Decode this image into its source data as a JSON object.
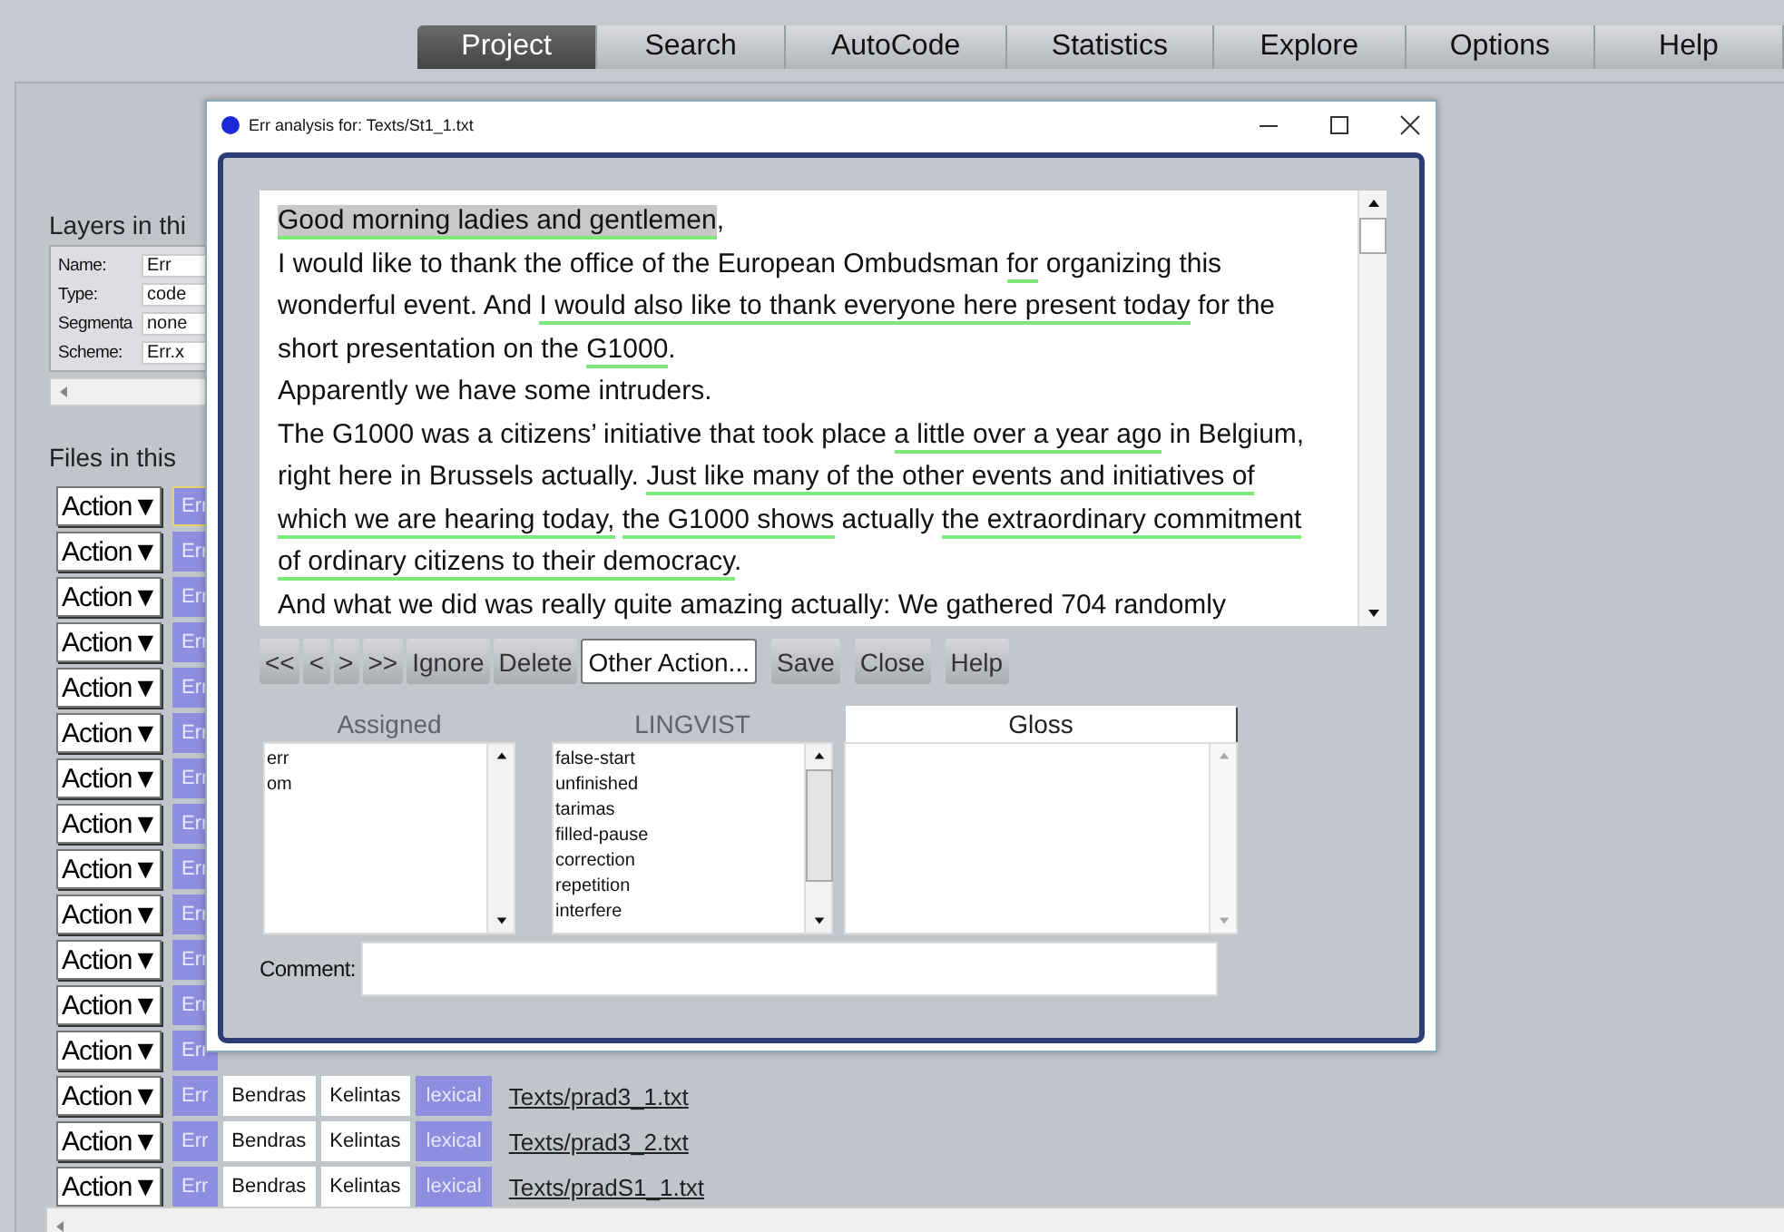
{
  "menu": [
    {
      "label": "Project",
      "selected": true
    },
    {
      "label": "Search",
      "selected": false
    },
    {
      "label": "AutoCode",
      "selected": false
    },
    {
      "label": "Statistics",
      "selected": false
    },
    {
      "label": "Explore",
      "selected": false
    },
    {
      "label": "Options",
      "selected": false
    },
    {
      "label": "Help",
      "selected": false
    }
  ],
  "layers": {
    "title": "Layers in thi",
    "fields": [
      {
        "label": "Name:",
        "value": "Err"
      },
      {
        "label": "Type:",
        "value": "code"
      },
      {
        "label": "Segmenta",
        "value": "none"
      },
      {
        "label": "Scheme:",
        "value": "Err.x"
      }
    ]
  },
  "files": {
    "title": "Files in this",
    "rows": [
      {
        "action": "Action▼",
        "tag": "Err",
        "selected": true
      },
      {
        "action": "Action▼",
        "tag": "Err",
        "selected": false
      },
      {
        "action": "Action▼",
        "tag": "Err",
        "selected": false
      },
      {
        "action": "Action▼",
        "tag": "Err",
        "selected": false
      },
      {
        "action": "Action▼",
        "tag": "Err",
        "selected": false
      },
      {
        "action": "Action▼",
        "tag": "Err",
        "selected": false
      },
      {
        "action": "Action▼",
        "tag": "Err",
        "selected": false
      },
      {
        "action": "Action▼",
        "tag": "Err",
        "selected": false
      },
      {
        "action": "Action▼",
        "tag": "Err",
        "selected": false
      },
      {
        "action": "Action▼",
        "tag": "Err",
        "selected": false
      },
      {
        "action": "Action▼",
        "tag": "Err",
        "selected": false
      },
      {
        "action": "Action▼",
        "tag": "Err",
        "selected": false
      },
      {
        "action": "Action▼",
        "tag": "Err",
        "selected": false
      },
      {
        "action": "Action▼",
        "tag": "Err",
        "selected": false,
        "cells": [
          "Bendras",
          "Kelintas"
        ],
        "type": "lexical",
        "file": "Texts/prad3_1.txt"
      },
      {
        "action": "Action▼",
        "tag": "Err",
        "selected": false,
        "cells": [
          "Bendras",
          "Kelintas"
        ],
        "type": "lexical",
        "file": "Texts/prad3_2.txt"
      },
      {
        "action": "Action▼",
        "tag": "Err",
        "selected": false,
        "cells": [
          "Bendras",
          "Kelintas"
        ],
        "type": "lexical",
        "file": "Texts/pradS1_1.txt"
      }
    ]
  },
  "dialog": {
    "title": "Err analysis for: Texts/St1_1.txt",
    "lines": [
      [
        {
          "text": "Good morning ladies and gentlemen",
          "underlined": true,
          "highlighted": true
        },
        {
          "text": ",",
          "underlined": false,
          "highlighted": false
        }
      ],
      [
        {
          "text": "I would like to thank the office of the European Ombudsman ",
          "underlined": false,
          "highlighted": false
        },
        {
          "text": "for",
          "underlined": true,
          "highlighted": false
        },
        {
          "text": " organizing this",
          "underlined": false,
          "highlighted": false
        }
      ],
      [
        {
          "text": "wonderful event. And ",
          "underlined": false,
          "highlighted": false
        },
        {
          "text": "I would also like to thank everyone here present today",
          "underlined": true,
          "highlighted": false
        },
        {
          "text": " for the",
          "underlined": false,
          "highlighted": false
        }
      ],
      [
        {
          "text": "short presentation on the ",
          "underlined": false,
          "highlighted": false
        },
        {
          "text": "G1000",
          "underlined": true,
          "highlighted": false
        },
        {
          "text": ".",
          "underlined": false,
          "highlighted": false
        }
      ],
      [
        {
          "text": "Apparently we have some intruders.",
          "underlined": false,
          "highlighted": false
        }
      ],
      [
        {
          "text": "The G1000 was a citizens’ initiative that took place ",
          "underlined": false,
          "highlighted": false
        },
        {
          "text": "a little over a year ago",
          "underlined": true,
          "highlighted": false
        },
        {
          "text": " in Belgium,",
          "underlined": false,
          "highlighted": false
        }
      ],
      [
        {
          "text": "right here in Brussels actually. ",
          "underlined": false,
          "highlighted": false
        },
        {
          "text": "Just like many of the other events and initiatives of",
          "underlined": true,
          "highlighted": false
        }
      ],
      [
        {
          "text": "which we are hearing today,",
          "underlined": true,
          "highlighted": false
        },
        {
          "text": "the G1000 shows",
          "underlined": true,
          "highlighted": false
        },
        {
          "text": " actually ",
          "underlined": false,
          "highlighted": false
        },
        {
          "text": "the extraordinary commitment",
          "underlined": true,
          "highlighted": false
        }
      ],
      [
        {
          "text": "of ordinary citizens to their democracy",
          "underlined": true,
          "highlighted": false
        },
        {
          "text": ".",
          "underlined": false,
          "highlighted": false
        }
      ],
      [
        {
          "text": "And what we did was really quite amazing actually: We gathered 704 randomly",
          "underlined": false,
          "highlighted": false
        }
      ]
    ],
    "buttons": [
      {
        "label": "<<",
        "kind": "plain"
      },
      {
        "label": "<",
        "kind": "plain"
      },
      {
        "label": ">",
        "kind": "plain"
      },
      {
        "label": ">>",
        "kind": "plain"
      },
      {
        "label": "Ignore",
        "kind": "plain"
      },
      {
        "label": "Delete",
        "kind": "plain"
      },
      {
        "label": "Other Action...",
        "kind": "menu"
      },
      {
        "label": "Save",
        "kind": "plain"
      },
      {
        "label": "Close",
        "kind": "plain"
      },
      {
        "label": "Help",
        "kind": "plain"
      }
    ],
    "lists": [
      {
        "header": "Assigned",
        "kind": "label",
        "items": [
          "err",
          "om"
        ]
      },
      {
        "header": "LINGVIST",
        "kind": "label",
        "items": [
          "false-start",
          "unfinished",
          "tarimas",
          "filled-pause",
          "correction",
          "repetition",
          "interfere"
        ]
      },
      {
        "header": "Gloss",
        "kind": "tab"
      }
    ],
    "comment": {
      "label": "Comment:"
    }
  }
}
